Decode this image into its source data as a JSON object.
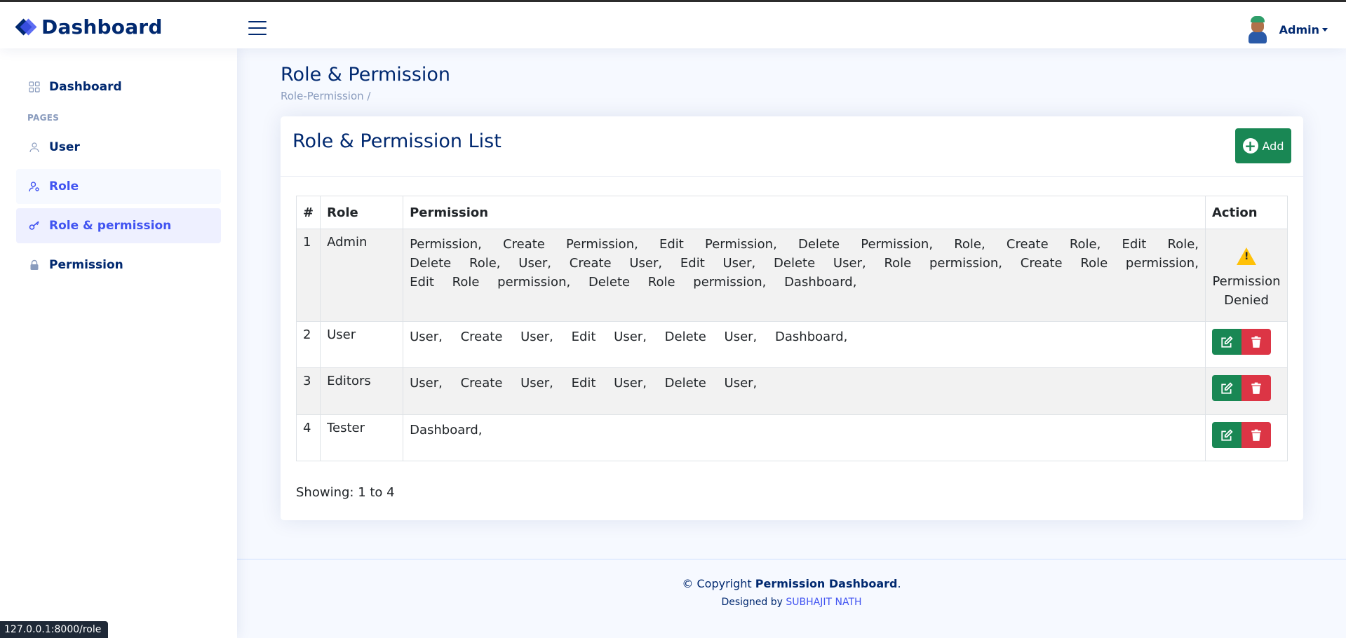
{
  "header": {
    "logo_text": "Dashboard",
    "user_name": "Admin"
  },
  "sidebar": {
    "heading_pages": "PAGES",
    "items": [
      {
        "label": "Dashboard",
        "icon": "grid-icon"
      },
      {
        "label": "User",
        "icon": "person-icon"
      },
      {
        "label": "Role",
        "icon": "person-gear-icon"
      },
      {
        "label": "Role & permission",
        "icon": "key-icon",
        "active": true
      },
      {
        "label": "Permission",
        "icon": "lock-icon"
      }
    ]
  },
  "page": {
    "title": "Role & Permission",
    "breadcrumb": "Role-Permission /"
  },
  "card": {
    "title": "Role & Permission List",
    "add_label": "Add",
    "columns": [
      "#",
      "Role",
      "Permission",
      "Action"
    ],
    "rows": [
      {
        "num": "1",
        "role": "Admin",
        "permissions": [
          "Permission,",
          "Create Permission,",
          "Edit Permission,",
          "Delete Permission,",
          "Role,",
          "Create Role,",
          "Edit Role,",
          "Delete Role,",
          "User,",
          "Create User,",
          "Edit User,",
          "Delete User,",
          "Role permission,",
          "Create Role permission,",
          "Edit Role permission,",
          "Delete Role permission,",
          "Dashboard,"
        ],
        "action_text": "Permission Denied"
      },
      {
        "num": "2",
        "role": "User",
        "permissions": [
          "User,",
          "Create User,",
          "Edit User,",
          "Delete User,",
          "Dashboard,"
        ]
      },
      {
        "num": "3",
        "role": "Editors",
        "permissions": [
          "User,",
          "Create User,",
          "Edit User,",
          "Delete User,"
        ]
      },
      {
        "num": "4",
        "role": "Tester",
        "permissions": [
          "Dashboard,"
        ]
      }
    ],
    "showing": "Showing: 1 to 4"
  },
  "footer": {
    "copyright_prefix": "© Copyright ",
    "copyright_brand": "Permission Dashboard",
    "copyright_suffix": ".",
    "designed_by": "Designed by ",
    "designer": "SUBHAJIT NATH"
  },
  "statusbar": {
    "url": "127.0.0.1:8000/role"
  },
  "colors": {
    "primary": "#012970",
    "accent": "#4154f1",
    "success": "#198754",
    "danger": "#dc3545",
    "warning": "#ffc107"
  }
}
